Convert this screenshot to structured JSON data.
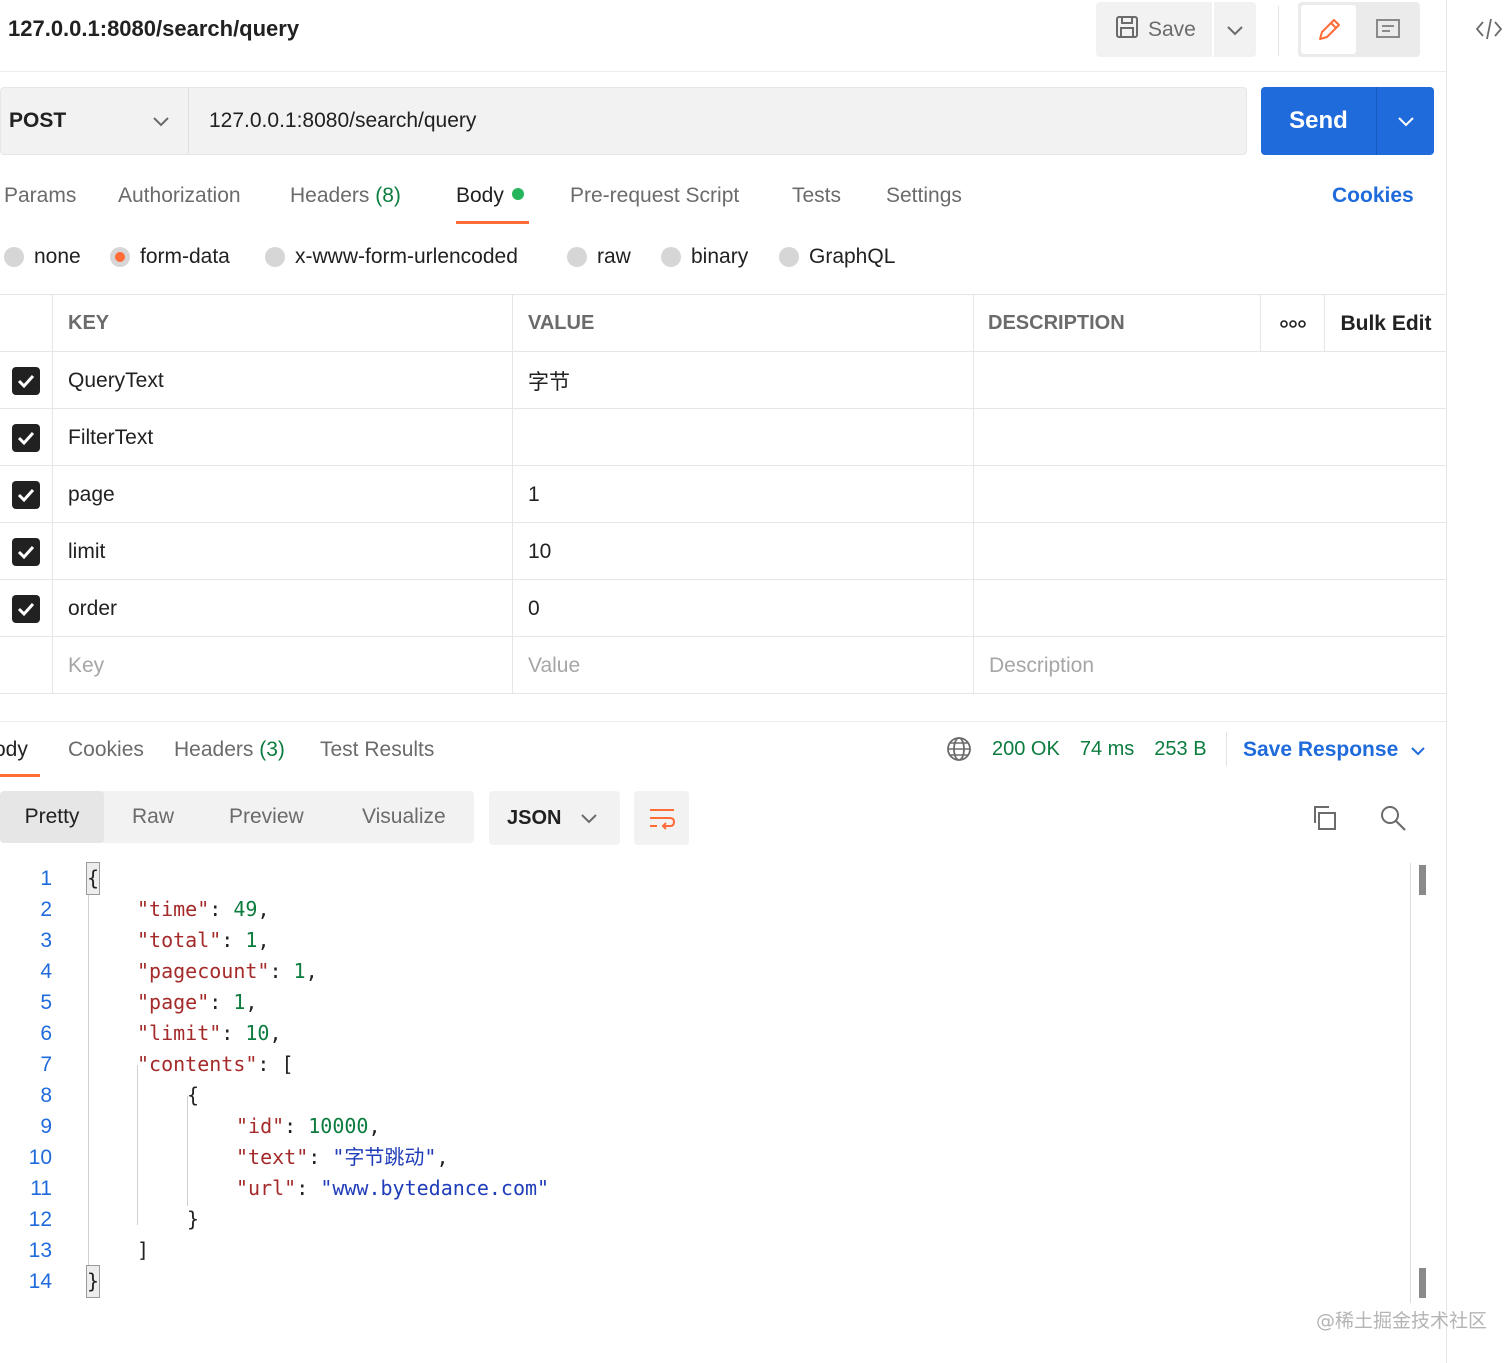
{
  "topbar": {
    "tab_title": "127.0.0.1:8080/search/query",
    "save_label": "Save"
  },
  "request": {
    "method": "POST",
    "url": "127.0.0.1:8080/search/query",
    "send_label": "Send",
    "tabs": [
      {
        "label": "Params",
        "count": ""
      },
      {
        "label": "Authorization",
        "count": ""
      },
      {
        "label": "Headers",
        "count": "(8)"
      },
      {
        "label": "Body",
        "count": ""
      },
      {
        "label": "Pre-request Script",
        "count": ""
      },
      {
        "label": "Tests",
        "count": ""
      },
      {
        "label": "Settings",
        "count": ""
      }
    ],
    "active_tab": "Body",
    "cookies_label": "Cookies"
  },
  "body_types": {
    "options": [
      "none",
      "form-data",
      "x-www-form-urlencoded",
      "raw",
      "binary",
      "GraphQL"
    ],
    "selected": "form-data"
  },
  "form_table": {
    "headers": {
      "key": "KEY",
      "value": "VALUE",
      "description": "DESCRIPTION",
      "more": "ooo",
      "bulk_edit": "Bulk Edit"
    },
    "rows": [
      {
        "checked": true,
        "key": "QueryText",
        "value": "字节",
        "description": ""
      },
      {
        "checked": true,
        "key": "FilterText",
        "value": "",
        "description": ""
      },
      {
        "checked": true,
        "key": "page",
        "value": "1",
        "description": ""
      },
      {
        "checked": true,
        "key": "limit",
        "value": "10",
        "description": ""
      },
      {
        "checked": true,
        "key": "order",
        "value": "0",
        "description": ""
      }
    ],
    "placeholders": {
      "key": "Key",
      "value": "Value",
      "description": "Description"
    }
  },
  "response": {
    "tabs": [
      {
        "label": "ody",
        "count": ""
      },
      {
        "label": "Cookies",
        "count": ""
      },
      {
        "label": "Headers",
        "count": "(3)"
      },
      {
        "label": "Test Results",
        "count": ""
      }
    ],
    "status": "200 OK",
    "time": "74 ms",
    "size": "253 B",
    "save_response_label": "Save Response",
    "view_modes": [
      "Pretty",
      "Raw",
      "Preview",
      "Visualize"
    ],
    "active_view": "Pretty",
    "format": "JSON"
  },
  "code_lines": [
    {
      "n": "1",
      "text": "{"
    },
    {
      "n": "2",
      "text": "\"time\": 49,"
    },
    {
      "n": "3",
      "text": "\"total\": 1,"
    },
    {
      "n": "4",
      "text": "\"pagecount\": 1,"
    },
    {
      "n": "5",
      "text": "\"page\": 1,"
    },
    {
      "n": "6",
      "text": "\"limit\": 10,"
    },
    {
      "n": "7",
      "text": "\"contents\": ["
    },
    {
      "n": "8",
      "text": "{"
    },
    {
      "n": "9",
      "text": "\"id\": 10000,"
    },
    {
      "n": "10",
      "text": "\"text\": \"字节跳动\","
    },
    {
      "n": "11",
      "text": "\"url\": \"www.bytedance.com\""
    },
    {
      "n": "12",
      "text": "}"
    },
    {
      "n": "13",
      "text": "]"
    },
    {
      "n": "14",
      "text": "}"
    }
  ],
  "watermark": "@稀土掘金技术社区",
  "colors": {
    "accent": "#ff6c37",
    "primary": "#1f6bdc",
    "success": "#0c7c3f"
  },
  "icons": [
    "save-icon",
    "chevron-down-icon",
    "pencil-icon",
    "comment-icon",
    "code-icon",
    "globe-icon",
    "wrap-lines-icon",
    "copy-icon",
    "search-icon",
    "checkmark-icon"
  ]
}
